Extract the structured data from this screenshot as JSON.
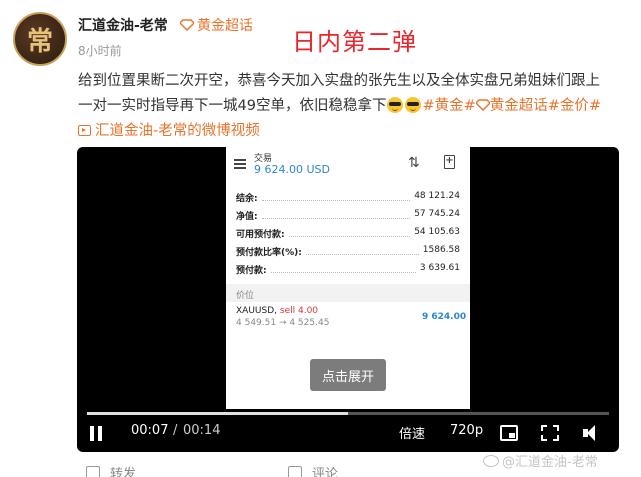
{
  "post": {
    "author": "汇道金油-老常",
    "badge": "黄金超话",
    "time": "8小时前",
    "avatar_char": "常",
    "overlay_title": "日内第二弹",
    "text_line1": "给到位置果断二次开空，恭喜今天加入实盘的张先生以及全体实盘兄弟姐妹们跟上",
    "text_line2": "一对一实时指导再下一城49空单，依旧稳稳拿下",
    "tag1": "#黄金#",
    "tag2": "黄金超话",
    "tag3": "#金价#",
    "video_link": "汇道金油-老常的微博视频"
  },
  "phone": {
    "label": "交易",
    "balance": "9 624.00 USD",
    "sort_icon": "sort-icon",
    "rows": [
      {
        "key": "结余:",
        "value": "48 121.24"
      },
      {
        "key": "净值:",
        "value": "57 745.24"
      },
      {
        "key": "可用预付款:",
        "value": "54 105.63"
      },
      {
        "key": "预付款比率(%):",
        "value": "1586.58"
      },
      {
        "key": "预付款:",
        "value": "3 639.61"
      }
    ],
    "section": "价位",
    "position_symbol": "XAUUSD,",
    "position_side": "sell 4.00",
    "position_prices": "4 549.51 → 4 525.45",
    "position_profit": "9 624.00"
  },
  "video": {
    "expand_label": "点击展开",
    "current_time": "00:07",
    "separator": "/",
    "total_time": "00:14",
    "progress": 0.5,
    "speed_label": "倍速",
    "quality_label": "720p"
  },
  "actions": {
    "share_label": "转发",
    "comment_label": "评论"
  },
  "watermark": "@汇道金油-老常",
  "colors": {
    "accent": "#e8742c",
    "title_red": "#e8262c",
    "blue": "#2b87d3"
  }
}
